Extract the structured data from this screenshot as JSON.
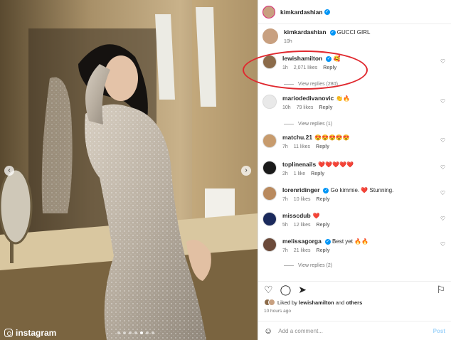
{
  "post": {
    "author": "kimkardashian",
    "caption": "GUCCI GIRL",
    "caption_time": "10h"
  },
  "photo": {
    "watermark": "instagram",
    "dots_count": 7,
    "active_dot": 4
  },
  "comments": [
    {
      "username": "lewishamilton",
      "verified": true,
      "text": "🥰",
      "time": "1h",
      "likes": "2,071 likes",
      "reply": "Reply",
      "view_replies": "View replies (280)",
      "avatar_color": "#8b6b4a"
    },
    {
      "username": "mariodedivanovic",
      "verified": false,
      "text": "👏🔥",
      "time": "10h",
      "likes": "79 likes",
      "reply": "Reply",
      "view_replies": "View replies (1)",
      "avatar_color": "#e9e9e9"
    },
    {
      "username": "matchu.21",
      "verified": false,
      "text": "😍😍😍😍😍",
      "time": "7h",
      "likes": "11 likes",
      "reply": "Reply",
      "view_replies": "",
      "avatar_color": "#c79b6d"
    },
    {
      "username": "toplinenails",
      "verified": false,
      "text": "❤️❤️❤️❤️❤️",
      "time": "2h",
      "likes": "1 like",
      "reply": "Reply",
      "view_replies": "",
      "avatar_color": "#1a1a1a"
    },
    {
      "username": "lorenridinger",
      "verified": true,
      "text": "Go kimmie. ❤️ Stunning.",
      "time": "7h",
      "likes": "10 likes",
      "reply": "Reply",
      "view_replies": "",
      "avatar_color": "#b98a5e"
    },
    {
      "username": "misscdub",
      "verified": false,
      "text": "❤️",
      "time": "5h",
      "likes": "12 likes",
      "reply": "Reply",
      "view_replies": "",
      "avatar_color": "#1b2a5c"
    },
    {
      "username": "melissagorga",
      "verified": true,
      "text": "Best yet 🔥🔥",
      "time": "7h",
      "likes": "21 likes",
      "reply": "Reply",
      "view_replies": "View replies (2)",
      "avatar_color": "#6b4a3a"
    }
  ],
  "actions": {
    "like_icon": "heart-icon",
    "comment_icon": "comment-icon",
    "share_icon": "share-icon",
    "save_icon": "bookmark-icon"
  },
  "liked_by": {
    "prefix": "Liked by",
    "user": "lewishamilton",
    "conj": "and",
    "others": "others"
  },
  "timeago": "10 hours ago",
  "add_comment": {
    "placeholder": "Add a comment...",
    "post_label": "Post"
  },
  "colors": {
    "accent": "#0095f6",
    "highlight": "#e0282e",
    "post_disabled": "#9fd3fa"
  }
}
